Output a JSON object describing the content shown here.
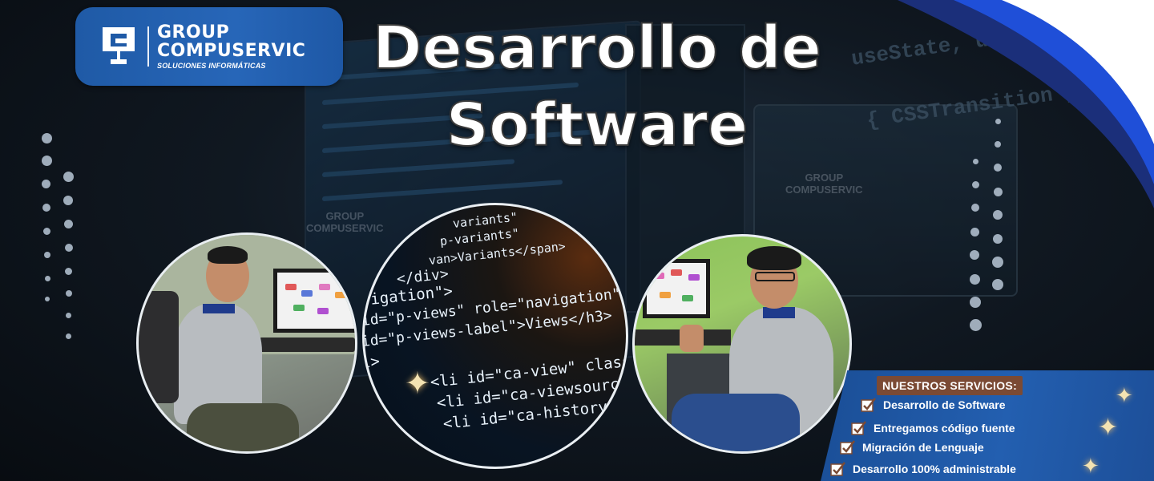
{
  "brand": {
    "line1": "GROUP",
    "line2": "COMPUSERVIC",
    "tagline": "SOLUCIONES INFORMÁTICAS",
    "color": "#2766b8"
  },
  "headline": {
    "line1": "Desarrollo de",
    "line2": "Software"
  },
  "watermark": {
    "line1": "GROUP",
    "line2": "COMPUSERVIC"
  },
  "center_code": {
    "lines": [
      "variants\"",
      "p-variants\"",
      "van>Variants</span>",
      "</div>",
      "vigation\">",
      "id=\"p-views\" role=\"navigation\"",
      "id=\"p-views-label\">Views</h3>",
      "l>",
      "<li id=\"ca-view\" class=\"selected\"",
      "<li id=\"ca-viewsource\"><a",
      "<li id=\"ca-history\" class=\""
    ],
    "bg_code_1": "useState, useEffect, useRef } from",
    "bg_code_2": "{ CSSTransition } from"
  },
  "services": {
    "title": "NUESTROS SERVICIOS:",
    "items": [
      "Desarrollo de Software",
      "Entregamos código fuente",
      "Migración de Lenguaje",
      "Desarrollo 100% administrable"
    ],
    "accent": "#7b4a34"
  },
  "icons": {
    "logo": "monitor-logo-icon",
    "check": "checkbox-check-icon",
    "sparkle": "sparkle-icon"
  },
  "colors": {
    "swoosh_blue": "#1f4fd8",
    "swoosh_navy": "#1b2f7a",
    "panel_blue": "#235fb0"
  }
}
